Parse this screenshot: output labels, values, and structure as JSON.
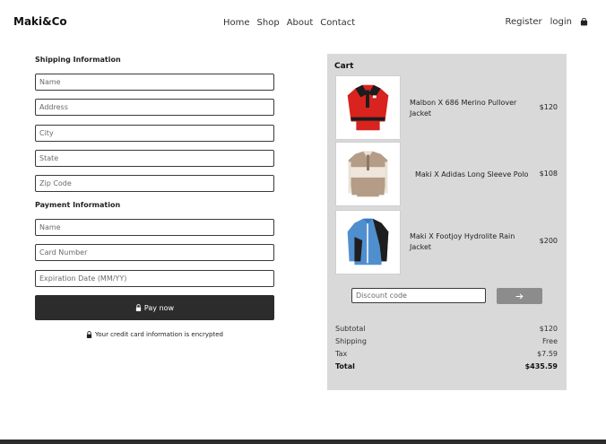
{
  "header": {
    "brand": "Maki&Co",
    "nav": [
      "Home",
      "Shop",
      "About",
      "Contact"
    ],
    "register": "Register",
    "login": "login",
    "bag_icon": "shopping-bag-icon"
  },
  "shipping": {
    "title": "Shipping Information",
    "name_placeholder": "Name",
    "address_placeholder": "Address",
    "city_placeholder": "City",
    "state_placeholder": "State",
    "zip_placeholder": "Zip Code"
  },
  "payment": {
    "title": "Payment Information",
    "name_placeholder": "Name",
    "card_placeholder": "Card Number",
    "expiry_placeholder": "Expiration Date (MM/YY)",
    "pay_label": "Pay now",
    "encrypted_note": "Your credit card information is encrypted"
  },
  "cart": {
    "title": "Cart",
    "items": [
      {
        "name": "Malbon X 686 Merino Pullover Jacket",
        "price": "$120"
      },
      {
        "name": "Maki X Adidas Long Sleeve Polo",
        "price": "$108"
      },
      {
        "name": "Maki X Footjoy Hydrolite Rain Jacket",
        "price": "$200"
      }
    ],
    "discount_placeholder": "Discount code",
    "apply_icon": "arrow-right-icon",
    "summary": {
      "subtotal_label": "Subtotal",
      "subtotal": "$120",
      "shipping_label": "Shipping",
      "shipping": "Free",
      "tax_label": "Tax",
      "tax": "$7.59",
      "total_label": "Total",
      "total": "$435.59"
    }
  }
}
